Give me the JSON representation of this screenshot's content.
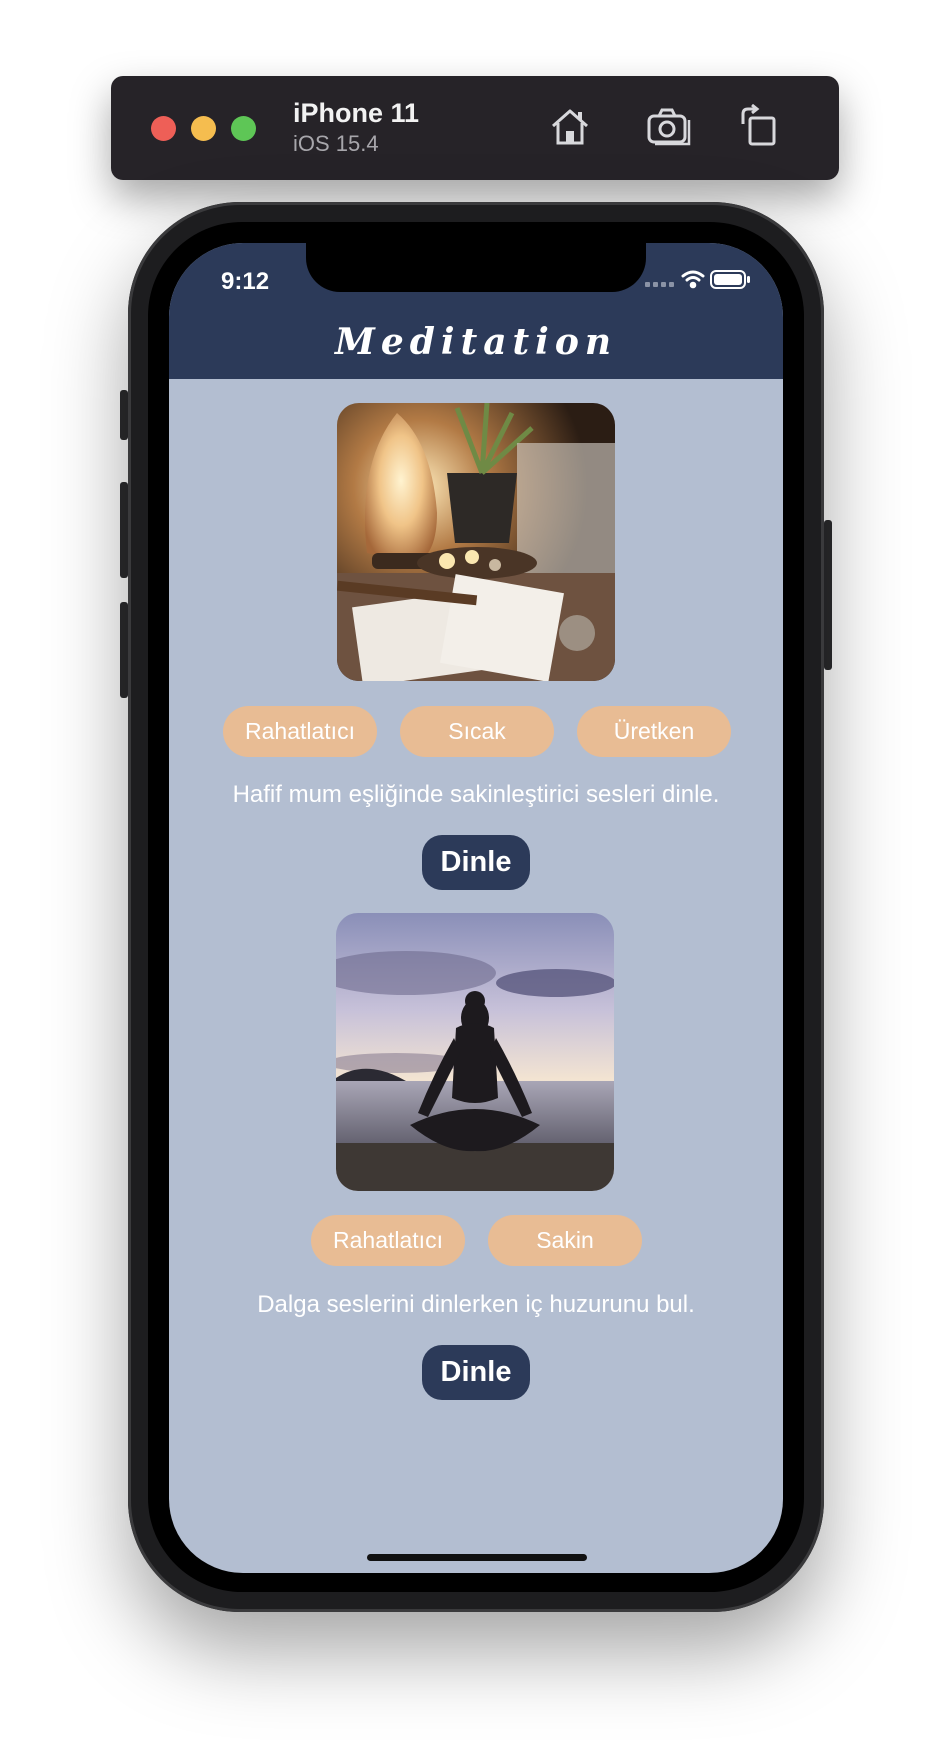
{
  "simulator": {
    "device_name": "iPhone 11",
    "os_version": "iOS 15.4",
    "toolbar_icons": [
      "home-icon",
      "camera-icon",
      "rotate-icon"
    ]
  },
  "status_bar": {
    "time": "9:12",
    "icons": [
      "signal-icon",
      "wifi-icon",
      "battery-icon"
    ]
  },
  "nav": {
    "title": "Meditation",
    "background": "#2c3a59"
  },
  "colors": {
    "screen_background": "#b3bed1",
    "tag_background": "#e8bc94",
    "button_background": "#2c3a59"
  },
  "cards": [
    {
      "image": "candle-crystal-photo",
      "tags": [
        "Rahatlatıcı",
        "Sıcak",
        "Üretken"
      ],
      "description": "Hafif mum eşliğinde sakinleştirici sesleri dinle.",
      "button": "Dinle"
    },
    {
      "image": "ocean-meditation-photo",
      "tags": [
        "Rahatlatıcı",
        "Sakin"
      ],
      "description": "Dalga seslerini dinlerken iç huzurunu bul.",
      "button": "Dinle"
    }
  ]
}
